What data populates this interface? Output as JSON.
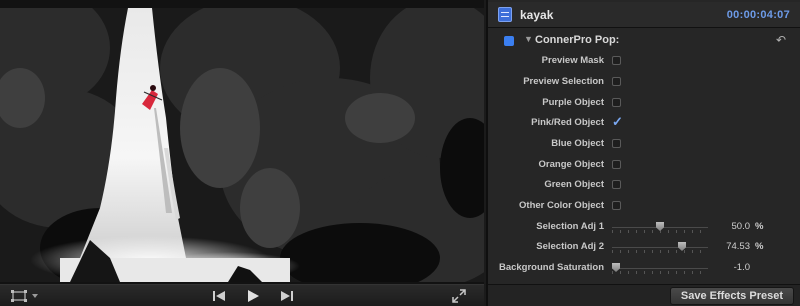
{
  "viewer": {
    "image": "waterfall-kayak-frame",
    "transport": {
      "prev_icon": "previous-frame-icon",
      "play_icon": "play-icon",
      "next_icon": "next-frame-icon"
    },
    "view_options_icon": "crop-view-icon",
    "fullscreen_icon": "fullscreen-icon"
  },
  "inspector": {
    "clip_name": "kayak",
    "timecode": "00:00:04:07",
    "effect": {
      "name": "ConnerPro Pop:",
      "enabled": true,
      "reset_icon": "reset-arrow-icon"
    },
    "checkbox_params": [
      {
        "label": "Preview Mask",
        "checked": false
      },
      {
        "label": "Preview Selection",
        "checked": false
      },
      {
        "label": "Purple Object",
        "checked": false
      },
      {
        "label": "Pink/Red  Object",
        "checked": true
      },
      {
        "label": "Blue Object",
        "checked": false
      },
      {
        "label": "Orange Object",
        "checked": false
      },
      {
        "label": "Green Object",
        "checked": false
      },
      {
        "label": "Other Color Object",
        "checked": false
      }
    ],
    "slider_params": [
      {
        "label": "Selection Adj 1",
        "value": "50.0",
        "unit": "%",
        "level": 0.5
      },
      {
        "label": "Selection Adj 2",
        "value": "74.53",
        "unit": "%",
        "level": 0.7453
      },
      {
        "label": "Background Saturation",
        "value": "-1.0",
        "unit": "",
        "level": 0.0
      }
    ],
    "save_button_label": "Save Effects Preset"
  },
  "colors": {
    "accent_blue": "#3b7ff1",
    "timecode_blue": "#6d9be8",
    "kayak_red": "#d8283c"
  }
}
